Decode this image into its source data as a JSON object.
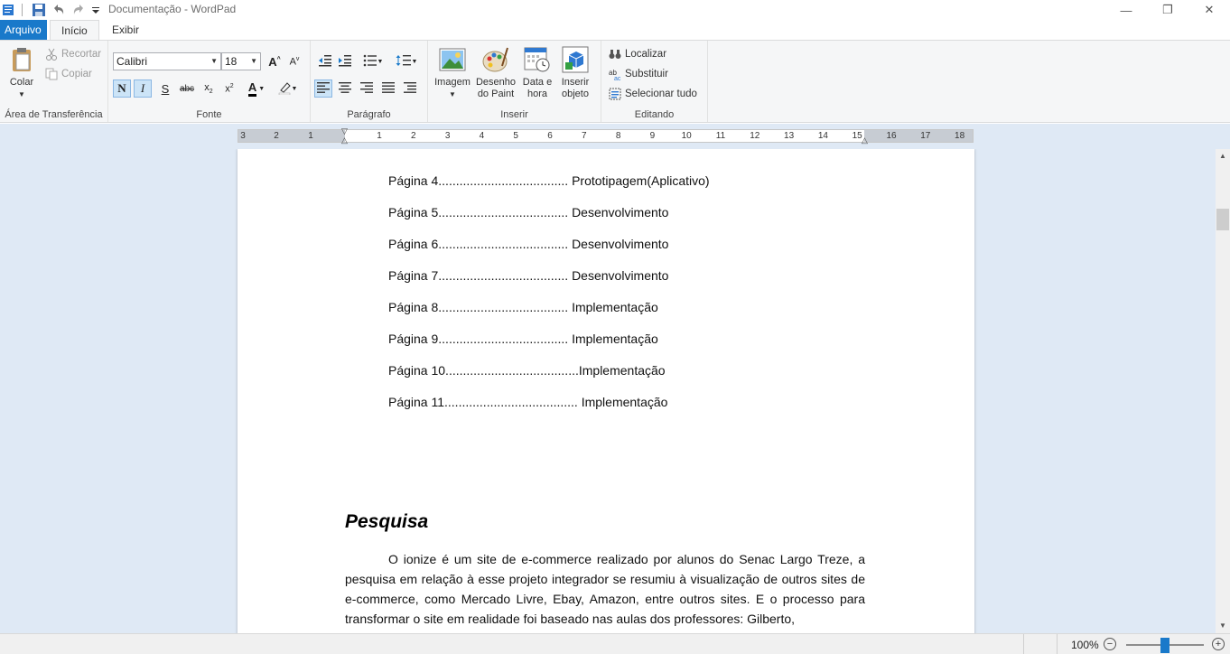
{
  "window": {
    "title": "Documentação - WordPad",
    "minimize_glyph": "—",
    "maximize_glyph": "❐",
    "close_glyph": "✕"
  },
  "tabs": {
    "file": "Arquivo",
    "home": "Início",
    "view": "Exibir"
  },
  "ribbon": {
    "clipboard": {
      "paste": "Colar",
      "cut": "Recortar",
      "copy": "Copiar",
      "label": "Área de Transferência"
    },
    "font": {
      "family": "Calibri",
      "size": "18",
      "bold": "N",
      "italic": "I",
      "underline": "S",
      "strike": "abc",
      "label": "Fonte"
    },
    "paragraph": {
      "label": "Parágrafo"
    },
    "insert": {
      "image": "Imagem",
      "paint_line1": "Desenho",
      "paint_line2": "do Paint",
      "datetime_line1": "Data e",
      "datetime_line2": "hora",
      "object_line1": "Inserir",
      "object_line2": "objeto",
      "label": "Inserir"
    },
    "editing": {
      "find": "Localizar",
      "replace": "Substituir",
      "select_all": "Selecionar tudo",
      "label": "Editando"
    }
  },
  "ruler": {
    "left_numbers": [
      "3",
      "2",
      "1"
    ],
    "right_numbers": [
      "1",
      "2",
      "3",
      "4",
      "5",
      "6",
      "7",
      "8",
      "9",
      "10",
      "11",
      "12",
      "13",
      "14",
      "15",
      "16",
      "17",
      "18"
    ]
  },
  "document": {
    "toc": [
      "Página 4..................................... Prototipagem(Aplicativo)",
      "Página 5..................................... Desenvolvimento",
      "Página 6..................................... Desenvolvimento",
      "Página 7..................................... Desenvolvimento",
      "Página 8..................................... Implementação",
      "Página 9..................................... Implementação",
      "Página 10......................................Implementação",
      "Página 11...................................... Implementação"
    ],
    "heading": "Pesquisa",
    "paragraph": "O ionize é um site de e-commerce realizado por alunos do Senac Largo Treze, a pesquisa em relação à esse projeto integrador se resumiu à visualização de outros sites de e-commerce, como Mercado Livre, Ebay, Amazon, entre outros sites. E o processo para transformar o site em realidade foi baseado nas aulas dos professores: Gilberto,"
  },
  "status": {
    "zoom": "100%",
    "zoom_fraction": 0.5
  }
}
